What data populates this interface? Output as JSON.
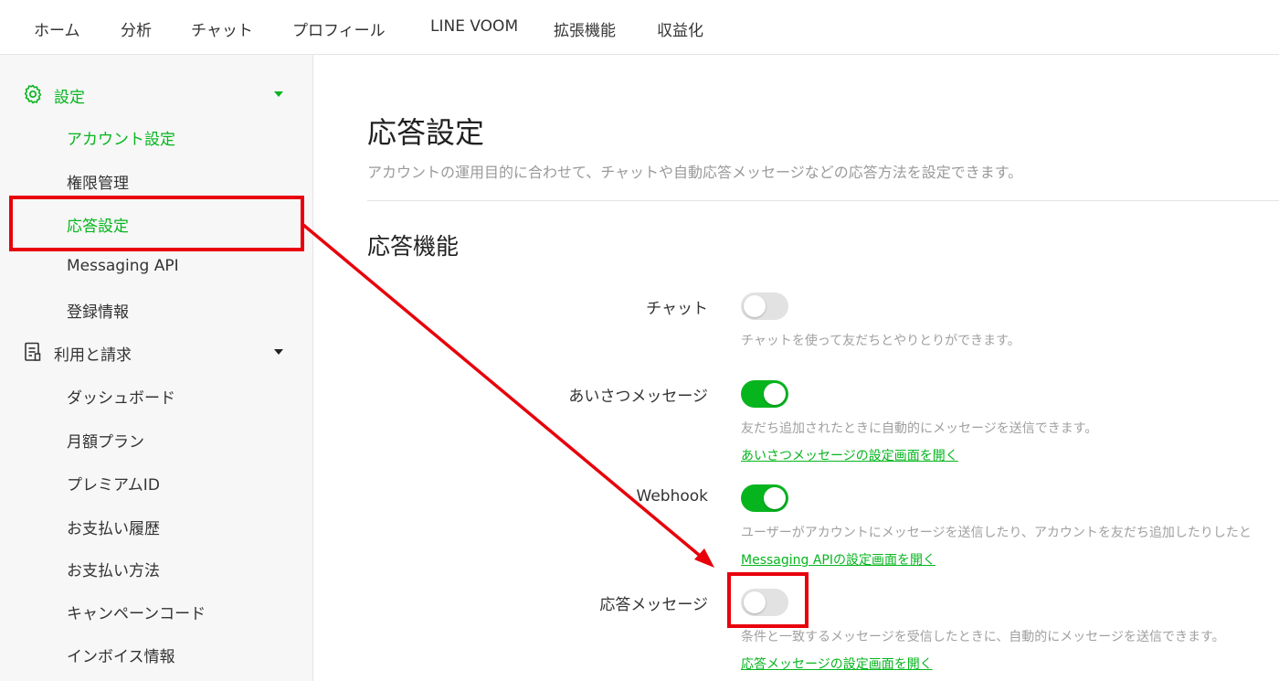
{
  "topnav": {
    "items": [
      "ホーム",
      "分析",
      "チャット",
      "プロフィール",
      "LINE VOOM",
      "拡張機能",
      "収益化"
    ]
  },
  "sidebar": {
    "settings": {
      "label": "設定",
      "icon": "gear-icon",
      "items": [
        "アカウント設定",
        "権限管理",
        "応答設定",
        "Messaging API",
        "登録情報"
      ]
    },
    "billing": {
      "label": "利用と請求",
      "icon": "document-icon",
      "items": [
        "ダッシュボード",
        "月額プラン",
        "プレミアムID",
        "お支払い履歴",
        "お支払い方法",
        "キャンペーンコード",
        "インボイス情報"
      ]
    }
  },
  "main": {
    "title": "応答設定",
    "description": "アカウントの運用目的に合わせて、チャットや自動応答メッセージなどの応答方法を設定できます。",
    "section_title": "応答機能",
    "rows": [
      {
        "label": "チャット",
        "enabled": false,
        "desc": "チャットを使って友だちとやりとりができます。",
        "link": ""
      },
      {
        "label": "あいさつメッセージ",
        "enabled": true,
        "desc": "友だち追加されたときに自動的にメッセージを送信できます。",
        "link": "あいさつメッセージの設定画面を開く"
      },
      {
        "label": "Webhook",
        "enabled": true,
        "desc": "ユーザーがアカウントにメッセージを送信したり、アカウントを友だち追加したりしたと",
        "link": "Messaging APIの設定画面を開く"
      },
      {
        "label": "応答メッセージ",
        "enabled": false,
        "desc": "条件と一致するメッセージを受信したときに、自動的にメッセージを送信できます。",
        "link": "応答メッセージの設定画面を開く"
      }
    ]
  },
  "colors": {
    "accent": "#06b51e",
    "annotation": "#e8000b"
  }
}
